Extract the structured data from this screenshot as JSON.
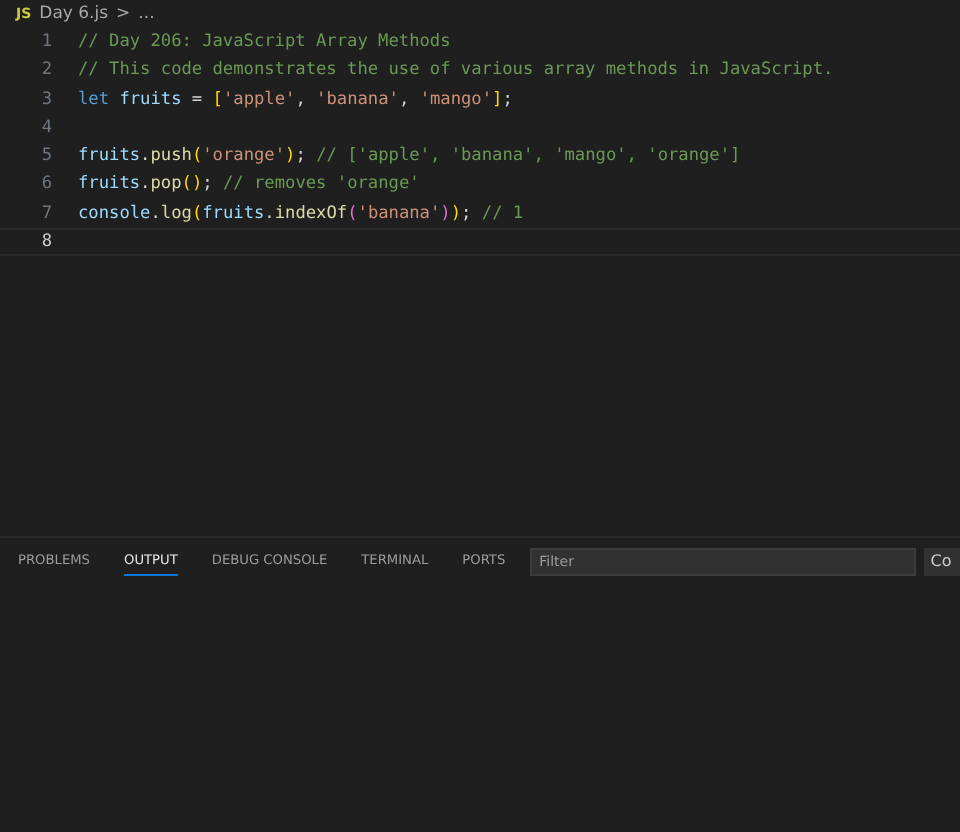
{
  "breadcrumb": {
    "file_icon": "JS",
    "file": "Day 6.js",
    "separator": ">",
    "trail": "..."
  },
  "editor": {
    "lines": [
      {
        "number": "1",
        "current": false,
        "tokens": [
          {
            "kind": "comment",
            "text": "// Day 206: JavaScript Array Methods"
          }
        ]
      },
      {
        "number": "2",
        "current": false,
        "tokens": [
          {
            "kind": "comment",
            "text": "// This code demonstrates the use of various array methods in JavaScript."
          }
        ]
      },
      {
        "number": "3",
        "current": false,
        "tokens": [
          {
            "kind": "keyword",
            "text": "let "
          },
          {
            "kind": "variable",
            "text": "fruits"
          },
          {
            "kind": "plain",
            "text": " = "
          },
          {
            "kind": "bracket",
            "text": "["
          },
          {
            "kind": "string",
            "text": "'apple'"
          },
          {
            "kind": "plain",
            "text": ", "
          },
          {
            "kind": "string",
            "text": "'banana'"
          },
          {
            "kind": "plain",
            "text": ", "
          },
          {
            "kind": "string",
            "text": "'mango'"
          },
          {
            "kind": "bracket",
            "text": "]"
          },
          {
            "kind": "plain",
            "text": ";"
          }
        ]
      },
      {
        "number": "4",
        "current": false
      },
      {
        "number": "5",
        "current": false,
        "tokens": [
          {
            "kind": "variable",
            "text": "fruits"
          },
          {
            "kind": "plain",
            "text": "."
          },
          {
            "kind": "function",
            "text": "push"
          },
          {
            "kind": "bracket",
            "text": "("
          },
          {
            "kind": "string",
            "text": "'orange'"
          },
          {
            "kind": "bracket",
            "text": ")"
          },
          {
            "kind": "plain",
            "text": "; "
          },
          {
            "kind": "comment",
            "text": "// ['apple', 'banana', 'mango', 'orange']"
          }
        ]
      },
      {
        "number": "6",
        "current": false,
        "tokens": [
          {
            "kind": "variable",
            "text": "fruits"
          },
          {
            "kind": "plain",
            "text": "."
          },
          {
            "kind": "function",
            "text": "pop"
          },
          {
            "kind": "bracket",
            "text": "()"
          },
          {
            "kind": "plain",
            "text": "; "
          },
          {
            "kind": "comment",
            "text": "// removes 'orange'"
          }
        ]
      },
      {
        "number": "7",
        "current": false,
        "tokens": [
          {
            "kind": "variable",
            "text": "console"
          },
          {
            "kind": "plain",
            "text": "."
          },
          {
            "kind": "function",
            "text": "log"
          },
          {
            "kind": "bracket",
            "text": "("
          },
          {
            "kind": "variable",
            "text": "fruits"
          },
          {
            "kind": "plain",
            "text": "."
          },
          {
            "kind": "function",
            "text": "indexOf"
          },
          {
            "kind": "bracket2",
            "text": "("
          },
          {
            "kind": "string",
            "text": "'banana'"
          },
          {
            "kind": "bracket2",
            "text": ")"
          },
          {
            "kind": "bracket",
            "text": ")"
          },
          {
            "kind": "plain",
            "text": "; "
          },
          {
            "kind": "comment",
            "text": "// 1"
          }
        ]
      },
      {
        "number": "8",
        "current": true
      }
    ]
  },
  "panel": {
    "tabs": [
      {
        "label": "PROBLEMS",
        "selected": false
      },
      {
        "label": "OUTPUT",
        "selected": true
      },
      {
        "label": "DEBUG CONSOLE",
        "selected": false
      },
      {
        "label": "TERMINAL",
        "selected": false
      },
      {
        "label": "PORTS",
        "selected": false
      }
    ],
    "filter": {
      "placeholder": "Filter"
    },
    "button": "Co"
  }
}
